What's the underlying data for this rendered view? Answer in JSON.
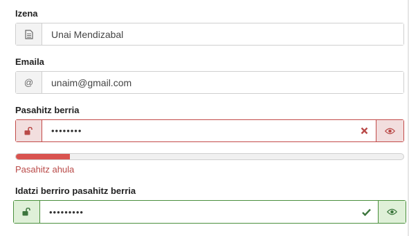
{
  "name_field": {
    "label": "Izena",
    "icon": "document-icon",
    "value": "Unai Mendizabal"
  },
  "email_field": {
    "label": "Emaila",
    "icon": "at-icon",
    "value": "unaim@gmail.com"
  },
  "new_password": {
    "label": "Pasahitz berria",
    "icon": "unlock-icon",
    "masked_value": "••••••••",
    "state": "error",
    "state_icon": "cross-icon",
    "toggle_icon": "eye-icon",
    "strength_fraction": 0.14,
    "strength_text": "Pasahitz ahula",
    "error_color": "#d9534f"
  },
  "confirm_password": {
    "label": "Idatzi berriro pasahitz berria",
    "icon": "unlock-icon",
    "masked_value": "•••••••••",
    "state": "success",
    "state_icon": "check-icon",
    "toggle_icon": "eye-icon",
    "success_color": "#3c763d"
  }
}
